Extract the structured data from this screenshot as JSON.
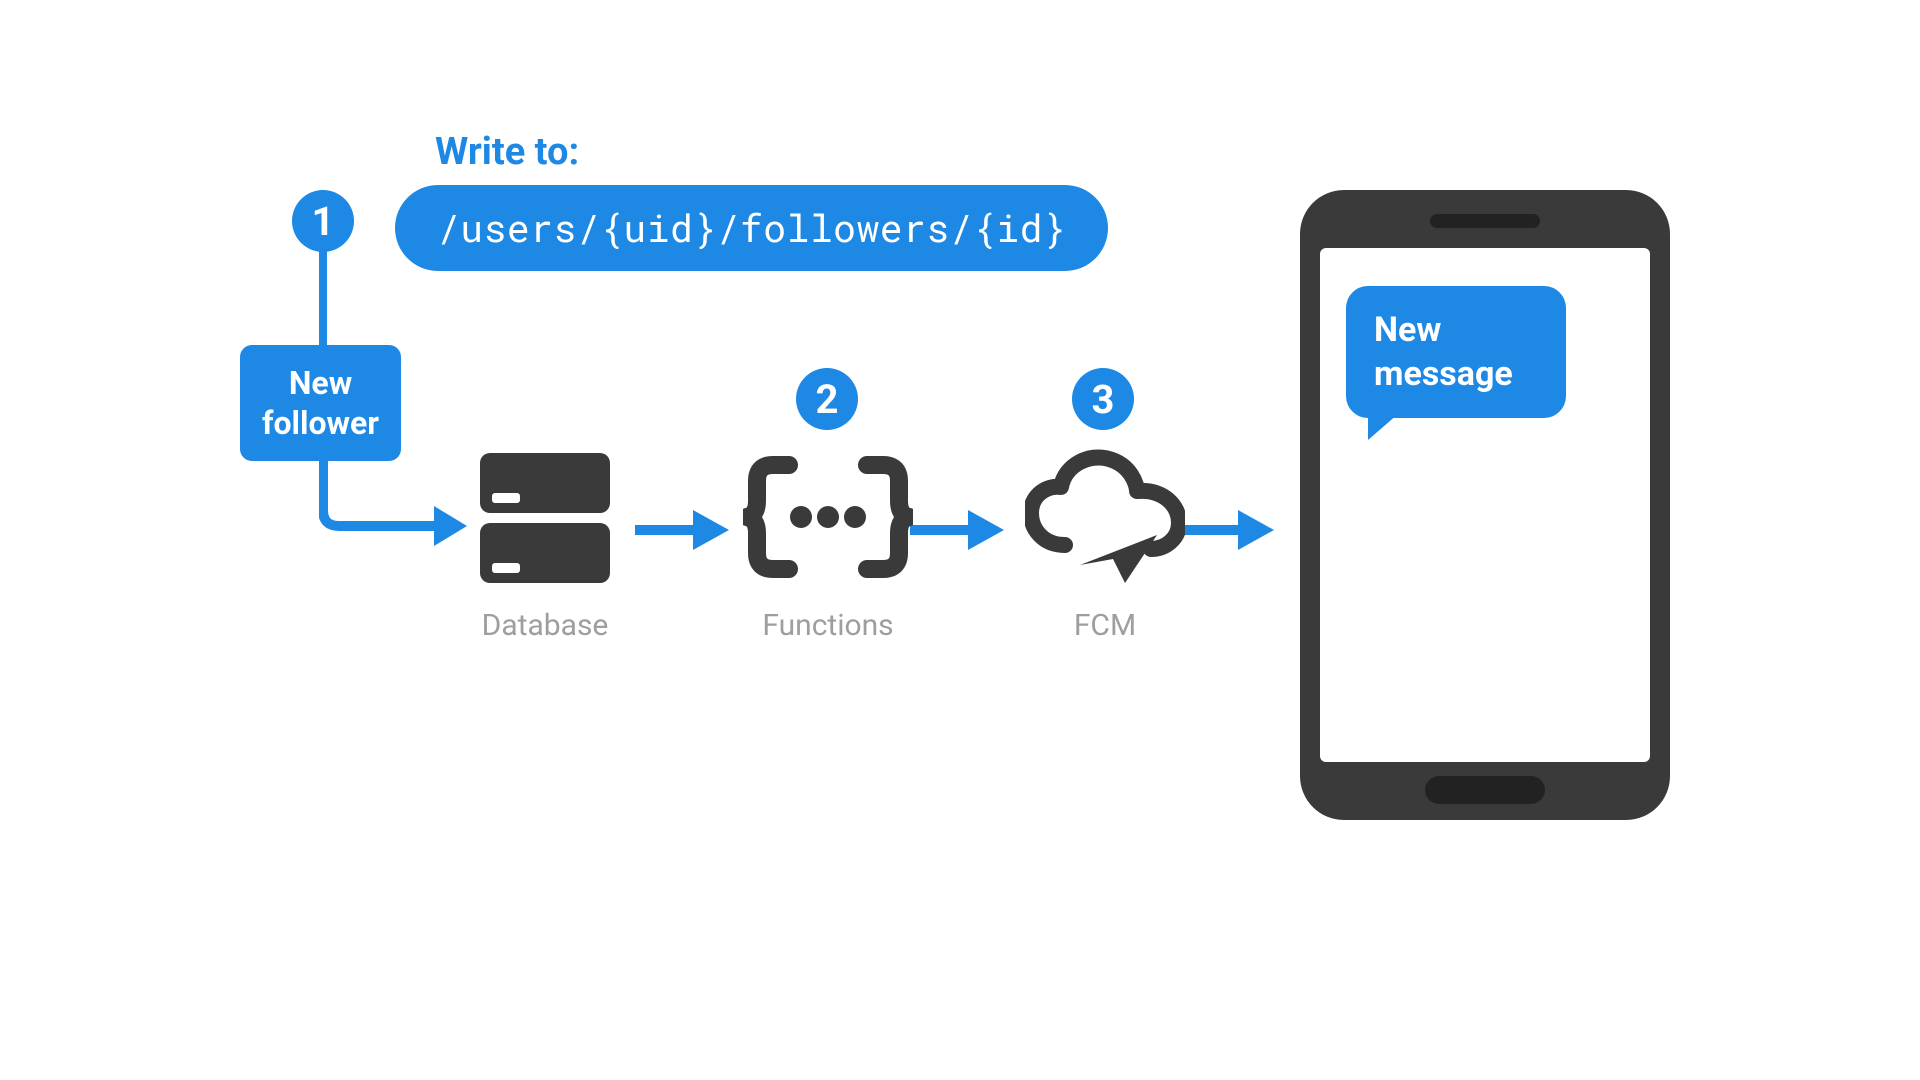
{
  "header": {
    "write_label": "Write to:",
    "path": "/users/{uid}/followers/{id}"
  },
  "badges": {
    "one": "1",
    "two": "2",
    "three": "3"
  },
  "new_follower": {
    "line1": "New",
    "line2": "follower"
  },
  "nodes": {
    "database": "Database",
    "functions": "Functions",
    "fcm": "FCM"
  },
  "phone": {
    "bubble_line1": "New",
    "bubble_line2": "message"
  },
  "colors": {
    "accent": "#1e88e5",
    "icon": "#3a3a3a",
    "caption": "#9e9e9e"
  }
}
